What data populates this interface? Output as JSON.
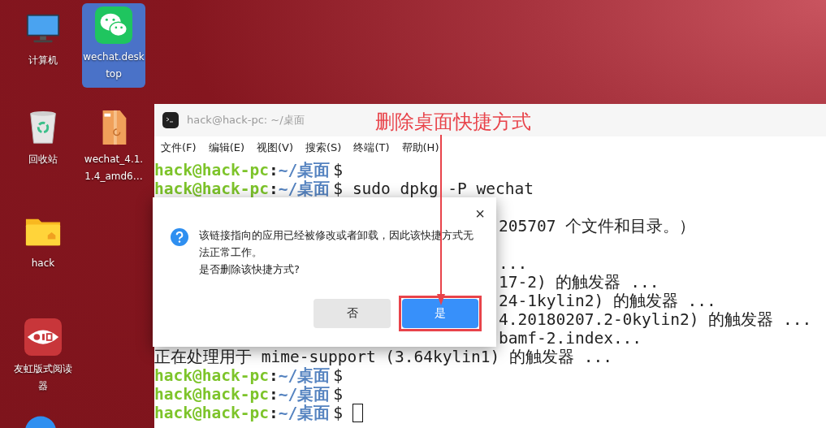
{
  "desktop_icons": [
    {
      "kind": "computer",
      "label": "计算机",
      "selected": false
    },
    {
      "kind": "wechat",
      "label": "wechat.desktop",
      "selected": true
    },
    {
      "kind": "trash",
      "label": "回收站",
      "selected": false
    },
    {
      "kind": "package",
      "label": "wechat_4.1.1.4_amd6…",
      "selected": false
    },
    {
      "kind": "folder",
      "label": "hack",
      "selected": false
    },
    {
      "kind": "reader",
      "label": "友虹版式阅读器",
      "selected": false
    },
    {
      "kind": "browser"
    }
  ],
  "terminal": {
    "title": "hack@hack-pc: ~/桌面",
    "menu": [
      "文件(F)",
      "编辑(E)",
      "视图(V)",
      "搜索(S)",
      "终端(T)",
      "帮助(H)"
    ],
    "lines": [
      {
        "kind": "prompt",
        "user": "hack@hack-pc",
        "separator": ":",
        "path": "~/桌面",
        "sign": "$"
      },
      {
        "kind": "prompt",
        "user": "hack@hack-pc",
        "separator": ":",
        "path": "~/桌面",
        "sign": "$",
        "command": "sudo dpkg -P wechat"
      },
      {
        "kind": "blank"
      },
      {
        "kind": "output",
        "covered": true,
        "text": "205707 个文件和目录。）"
      },
      {
        "kind": "blank"
      },
      {
        "kind": "output",
        "covered": true,
        "text": "..."
      },
      {
        "kind": "output",
        "covered": true,
        "text": "17-2) 的触发器 ..."
      },
      {
        "kind": "output",
        "covered": true,
        "text": "24-1kylin2) 的触发器 ..."
      },
      {
        "kind": "output",
        "covered": true,
        "text": "4.20180207.2-0kylin2) 的触发器 ..."
      },
      {
        "kind": "output",
        "covered": true,
        "text": "bamf-2.index..."
      },
      {
        "kind": "output",
        "covered": false,
        "text": "正在处理用于 mime-support (3.64kylin1) 的触发器 ..."
      },
      {
        "kind": "prompt",
        "user": "hack@hack-pc",
        "separator": ":",
        "path": "~/桌面",
        "sign": "$"
      },
      {
        "kind": "prompt",
        "user": "hack@hack-pc",
        "separator": ":",
        "path": "~/桌面",
        "sign": "$"
      },
      {
        "kind": "prompt",
        "user": "hack@hack-pc",
        "separator": ":",
        "path": "~/桌面",
        "sign": "$",
        "cursor": true
      }
    ]
  },
  "dialog": {
    "message": [
      "该链接指向的应用已经被修改或者卸载，因此该快捷方式无法正常工作。",
      "是否删除该快捷方式?"
    ],
    "close": "×",
    "buttons": [
      {
        "label": "否",
        "kind": "secondary",
        "highlighted": false
      },
      {
        "label": "是",
        "kind": "primary",
        "highlighted": true
      }
    ]
  },
  "annotation": {
    "text": "删除桌面快捷方式"
  }
}
